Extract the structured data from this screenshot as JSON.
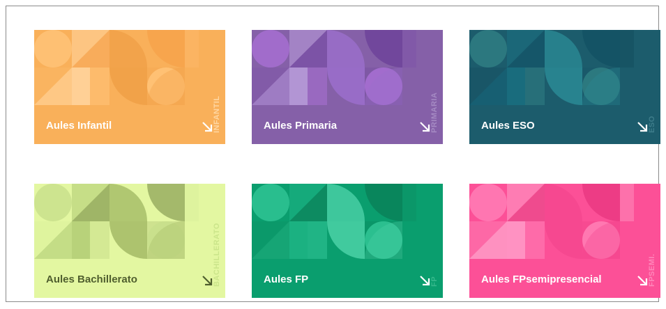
{
  "cards": [
    {
      "title": "Aules Infantil",
      "vertical_label": "INFANTIL",
      "bg": "#F9B05A",
      "text_color": "#FFFFFF",
      "vlabel_color": "#FFD7A3",
      "arrow_color": "#FFFFFF"
    },
    {
      "title": "Aules Primaria",
      "vertical_label": "PRIMARIA",
      "bg": "#8560A8",
      "text_color": "#FFFFFF",
      "vlabel_color": "#A58AC3",
      "arrow_color": "#FFFFFF"
    },
    {
      "title": "Aules ESO",
      "vertical_label": "ESO",
      "bg": "#1C5C6C",
      "text_color": "#FFFFFF",
      "vlabel_color": "#3D7C8A",
      "arrow_color": "#FFFFFF"
    },
    {
      "title": "Aules Bachillerato",
      "vertical_label": "BACHILLERATO",
      "bg": "#E3F7A1",
      "text_color": "#4F5E2E",
      "vlabel_color": "#CBE58A",
      "arrow_color": "#4F5E2E"
    },
    {
      "title": "Aules FP",
      "vertical_label": "FP",
      "bg": "#0A9E6E",
      "text_color": "#FFFFFF",
      "vlabel_color": "#36B88C",
      "arrow_color": "#FFFFFF"
    },
    {
      "title": "Aules FPsemipresencial",
      "vertical_label": "FPSEMI.",
      "bg": "#FC5097",
      "text_color": "#FFFFFF",
      "vlabel_color": "#FF86BA",
      "arrow_color": "#FFFFFF"
    }
  ],
  "palettes": [
    [
      "#FFC378",
      "#F5A14A",
      "#FFD49C",
      "#F0A047",
      "#FFBE73"
    ],
    [
      "#A66FD1",
      "#6B3F98",
      "#B79BD8",
      "#9B6FCC",
      "#7A4DA8"
    ],
    [
      "#2F7C82",
      "#125063",
      "#1A6E80",
      "#2A8A95",
      "#0F4457"
    ],
    [
      "#C9E08C",
      "#8FA45A",
      "#B3CD76",
      "#A3BA65",
      "#D5EC99"
    ],
    [
      "#2FC394",
      "#0A7E57",
      "#1DB383",
      "#4BD1A7",
      "#0E8A60"
    ],
    [
      "#FF7DB5",
      "#E8367F",
      "#FF99C6",
      "#F4468E",
      "#FFB0D2"
    ]
  ]
}
